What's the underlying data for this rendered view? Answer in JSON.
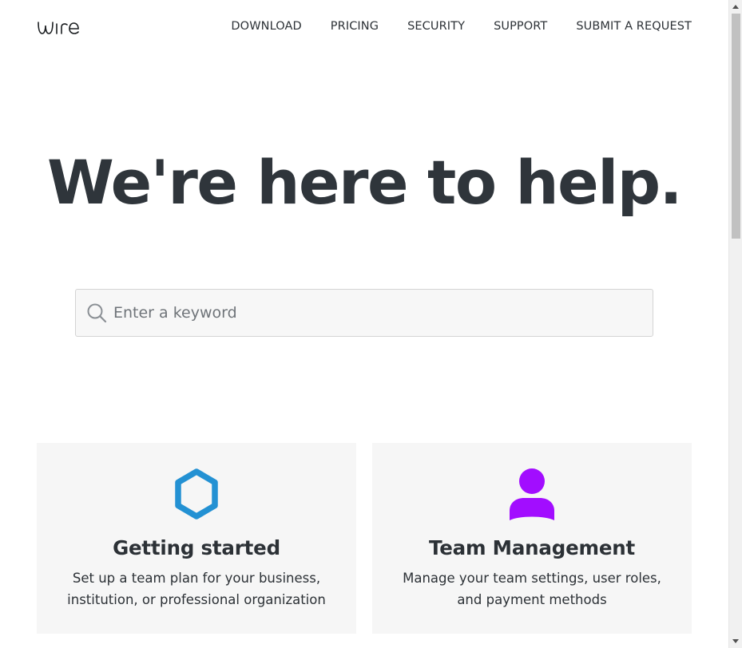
{
  "header": {
    "logo_text": "wire",
    "nav": [
      "DOWNLOAD",
      "PRICING",
      "SECURITY",
      "SUPPORT",
      "SUBMIT A REQUEST"
    ]
  },
  "hero": {
    "title": "We're here to help."
  },
  "search": {
    "placeholder": "Enter a keyword",
    "value": "",
    "icon": "search-icon"
  },
  "cards": [
    {
      "title": "Getting started",
      "description": "Set up a team plan for your business, institution, or professional organization",
      "icon": "hexagon-icon",
      "icon_color": "#2391d3"
    },
    {
      "title": "Team Management",
      "description": "Manage your team settings, user roles, and payment methods",
      "icon": "user-icon",
      "icon_color": "#a20dff"
    }
  ]
}
